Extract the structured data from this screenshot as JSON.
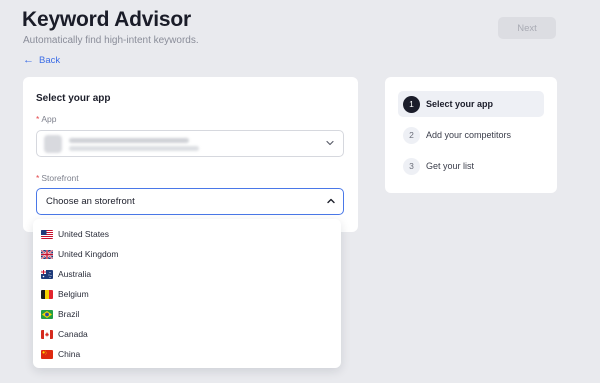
{
  "header": {
    "title": "Keyword Advisor",
    "subtitle": "Automatically find high-intent keywords.",
    "back_label": "Back",
    "next_label": "Next"
  },
  "form": {
    "section_title": "Select your app",
    "app_label": "App",
    "storefront_label": "Storefront",
    "storefront_value": "Choose an storefront"
  },
  "storefronts": [
    {
      "label": "United States",
      "flag": "us-flag"
    },
    {
      "label": "United Kingdom",
      "flag": "uk-flag"
    },
    {
      "label": "Australia",
      "flag": "au-flag"
    },
    {
      "label": "Belgium",
      "flag": "be-flag"
    },
    {
      "label": "Brazil",
      "flag": "br-flag"
    },
    {
      "label": "Canada",
      "flag": "ca-flag"
    },
    {
      "label": "China",
      "flag": "cn-flag"
    }
  ],
  "steps": [
    {
      "number": "1",
      "label": "Select your app",
      "active": true
    },
    {
      "number": "2",
      "label": "Add your competitors",
      "active": false
    },
    {
      "number": "3",
      "label": "Get your list",
      "active": false
    }
  ],
  "colors": {
    "background": "#e9eaee",
    "accent": "#3d6ee6",
    "focus_border": "#4a78e8",
    "required": "#e5484d",
    "step_active": "#1b1d2a"
  }
}
